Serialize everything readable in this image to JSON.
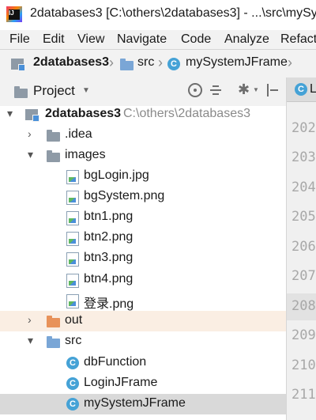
{
  "window": {
    "title": "2databases3 [C:\\others\\2databases3] - ...\\src\\mySy"
  },
  "menu": [
    "File",
    "Edit",
    "View",
    "Navigate",
    "Code",
    "Analyze",
    "Refact"
  ],
  "breadcrumb": [
    "2databases3",
    "src",
    "mySystemJFrame"
  ],
  "toolwindow": {
    "title": "Project",
    "dropdown": "▼"
  },
  "tree": {
    "root": {
      "name": "2databases3",
      "path": "C:\\others\\2databases3"
    },
    "items": [
      {
        "name": ".idea"
      },
      {
        "name": "images"
      },
      {
        "name": "bgLogin.jpg"
      },
      {
        "name": "bgSystem.png"
      },
      {
        "name": "btn1.png"
      },
      {
        "name": "btn2.png"
      },
      {
        "name": "btn3.png"
      },
      {
        "name": "btn4.png"
      },
      {
        "name": "登录.png"
      },
      {
        "name": "out"
      },
      {
        "name": "src"
      },
      {
        "name": "dbFunction"
      },
      {
        "name": "LoginJFrame"
      },
      {
        "name": "mySystemJFrame"
      }
    ]
  },
  "editor": {
    "tab_label": "L",
    "line_numbers": [
      "202",
      "203",
      "204",
      "205",
      "206",
      "207",
      "208",
      "209",
      "210",
      "211"
    ]
  },
  "colors": {
    "class_icon": "#45a2d6",
    "out_folder": "#e8925a",
    "src_folder": "#7aa6d6",
    "selection": "#d9d9d9"
  }
}
